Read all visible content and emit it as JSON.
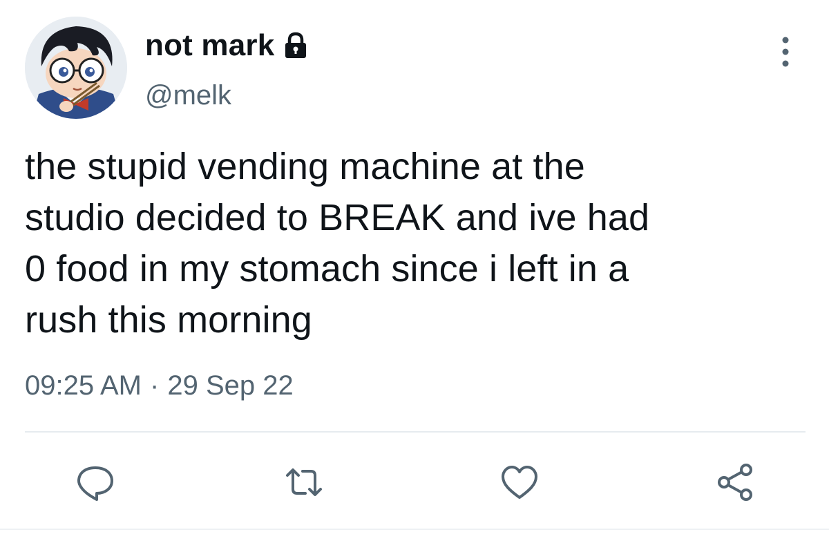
{
  "tweet": {
    "display_name": "not mark",
    "handle": "@melk",
    "text": "the stupid vending machine at the\nstudio decided to BREAK and ive had\n0 food in my stomach since i left in a\nrush this morning",
    "time": "09:25 AM",
    "separator": "·",
    "date": "29 Sep 22",
    "protected_icon": "lock-icon",
    "avatar_description_icon": "avatar"
  },
  "actions": {
    "reply_icon": "reply-icon",
    "retweet_icon": "retweet-icon",
    "like_icon": "heart-icon",
    "share_icon": "share-icon",
    "more_icon": "more-vertical-icon"
  },
  "colors": {
    "text_primary": "#0f1419",
    "text_secondary": "#536471",
    "divider": "#e6ebef"
  }
}
